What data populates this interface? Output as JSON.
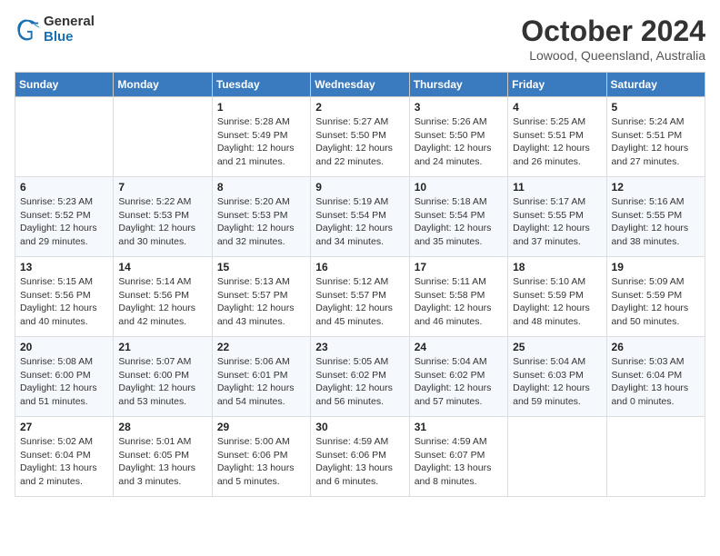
{
  "header": {
    "logo_general": "General",
    "logo_blue": "Blue",
    "month_title": "October 2024",
    "location": "Lowood, Queensland, Australia"
  },
  "days_of_week": [
    "Sunday",
    "Monday",
    "Tuesday",
    "Wednesday",
    "Thursday",
    "Friday",
    "Saturday"
  ],
  "weeks": [
    [
      {
        "day": "",
        "info": ""
      },
      {
        "day": "",
        "info": ""
      },
      {
        "day": "1",
        "sunrise": "Sunrise: 5:28 AM",
        "sunset": "Sunset: 5:49 PM",
        "daylight": "Daylight: 12 hours and 21 minutes."
      },
      {
        "day": "2",
        "sunrise": "Sunrise: 5:27 AM",
        "sunset": "Sunset: 5:50 PM",
        "daylight": "Daylight: 12 hours and 22 minutes."
      },
      {
        "day": "3",
        "sunrise": "Sunrise: 5:26 AM",
        "sunset": "Sunset: 5:50 PM",
        "daylight": "Daylight: 12 hours and 24 minutes."
      },
      {
        "day": "4",
        "sunrise": "Sunrise: 5:25 AM",
        "sunset": "Sunset: 5:51 PM",
        "daylight": "Daylight: 12 hours and 26 minutes."
      },
      {
        "day": "5",
        "sunrise": "Sunrise: 5:24 AM",
        "sunset": "Sunset: 5:51 PM",
        "daylight": "Daylight: 12 hours and 27 minutes."
      }
    ],
    [
      {
        "day": "6",
        "sunrise": "Sunrise: 5:23 AM",
        "sunset": "Sunset: 5:52 PM",
        "daylight": "Daylight: 12 hours and 29 minutes."
      },
      {
        "day": "7",
        "sunrise": "Sunrise: 5:22 AM",
        "sunset": "Sunset: 5:53 PM",
        "daylight": "Daylight: 12 hours and 30 minutes."
      },
      {
        "day": "8",
        "sunrise": "Sunrise: 5:20 AM",
        "sunset": "Sunset: 5:53 PM",
        "daylight": "Daylight: 12 hours and 32 minutes."
      },
      {
        "day": "9",
        "sunrise": "Sunrise: 5:19 AM",
        "sunset": "Sunset: 5:54 PM",
        "daylight": "Daylight: 12 hours and 34 minutes."
      },
      {
        "day": "10",
        "sunrise": "Sunrise: 5:18 AM",
        "sunset": "Sunset: 5:54 PM",
        "daylight": "Daylight: 12 hours and 35 minutes."
      },
      {
        "day": "11",
        "sunrise": "Sunrise: 5:17 AM",
        "sunset": "Sunset: 5:55 PM",
        "daylight": "Daylight: 12 hours and 37 minutes."
      },
      {
        "day": "12",
        "sunrise": "Sunrise: 5:16 AM",
        "sunset": "Sunset: 5:55 PM",
        "daylight": "Daylight: 12 hours and 38 minutes."
      }
    ],
    [
      {
        "day": "13",
        "sunrise": "Sunrise: 5:15 AM",
        "sunset": "Sunset: 5:56 PM",
        "daylight": "Daylight: 12 hours and 40 minutes."
      },
      {
        "day": "14",
        "sunrise": "Sunrise: 5:14 AM",
        "sunset": "Sunset: 5:56 PM",
        "daylight": "Daylight: 12 hours and 42 minutes."
      },
      {
        "day": "15",
        "sunrise": "Sunrise: 5:13 AM",
        "sunset": "Sunset: 5:57 PM",
        "daylight": "Daylight: 12 hours and 43 minutes."
      },
      {
        "day": "16",
        "sunrise": "Sunrise: 5:12 AM",
        "sunset": "Sunset: 5:57 PM",
        "daylight": "Daylight: 12 hours and 45 minutes."
      },
      {
        "day": "17",
        "sunrise": "Sunrise: 5:11 AM",
        "sunset": "Sunset: 5:58 PM",
        "daylight": "Daylight: 12 hours and 46 minutes."
      },
      {
        "day": "18",
        "sunrise": "Sunrise: 5:10 AM",
        "sunset": "Sunset: 5:59 PM",
        "daylight": "Daylight: 12 hours and 48 minutes."
      },
      {
        "day": "19",
        "sunrise": "Sunrise: 5:09 AM",
        "sunset": "Sunset: 5:59 PM",
        "daylight": "Daylight: 12 hours and 50 minutes."
      }
    ],
    [
      {
        "day": "20",
        "sunrise": "Sunrise: 5:08 AM",
        "sunset": "Sunset: 6:00 PM",
        "daylight": "Daylight: 12 hours and 51 minutes."
      },
      {
        "day": "21",
        "sunrise": "Sunrise: 5:07 AM",
        "sunset": "Sunset: 6:00 PM",
        "daylight": "Daylight: 12 hours and 53 minutes."
      },
      {
        "day": "22",
        "sunrise": "Sunrise: 5:06 AM",
        "sunset": "Sunset: 6:01 PM",
        "daylight": "Daylight: 12 hours and 54 minutes."
      },
      {
        "day": "23",
        "sunrise": "Sunrise: 5:05 AM",
        "sunset": "Sunset: 6:02 PM",
        "daylight": "Daylight: 12 hours and 56 minutes."
      },
      {
        "day": "24",
        "sunrise": "Sunrise: 5:04 AM",
        "sunset": "Sunset: 6:02 PM",
        "daylight": "Daylight: 12 hours and 57 minutes."
      },
      {
        "day": "25",
        "sunrise": "Sunrise: 5:04 AM",
        "sunset": "Sunset: 6:03 PM",
        "daylight": "Daylight: 12 hours and 59 minutes."
      },
      {
        "day": "26",
        "sunrise": "Sunrise: 5:03 AM",
        "sunset": "Sunset: 6:04 PM",
        "daylight": "Daylight: 13 hours and 0 minutes."
      }
    ],
    [
      {
        "day": "27",
        "sunrise": "Sunrise: 5:02 AM",
        "sunset": "Sunset: 6:04 PM",
        "daylight": "Daylight: 13 hours and 2 minutes."
      },
      {
        "day": "28",
        "sunrise": "Sunrise: 5:01 AM",
        "sunset": "Sunset: 6:05 PM",
        "daylight": "Daylight: 13 hours and 3 minutes."
      },
      {
        "day": "29",
        "sunrise": "Sunrise: 5:00 AM",
        "sunset": "Sunset: 6:06 PM",
        "daylight": "Daylight: 13 hours and 5 minutes."
      },
      {
        "day": "30",
        "sunrise": "Sunrise: 4:59 AM",
        "sunset": "Sunset: 6:06 PM",
        "daylight": "Daylight: 13 hours and 6 minutes."
      },
      {
        "day": "31",
        "sunrise": "Sunrise: 4:59 AM",
        "sunset": "Sunset: 6:07 PM",
        "daylight": "Daylight: 13 hours and 8 minutes."
      },
      {
        "day": "",
        "info": ""
      },
      {
        "day": "",
        "info": ""
      }
    ]
  ]
}
